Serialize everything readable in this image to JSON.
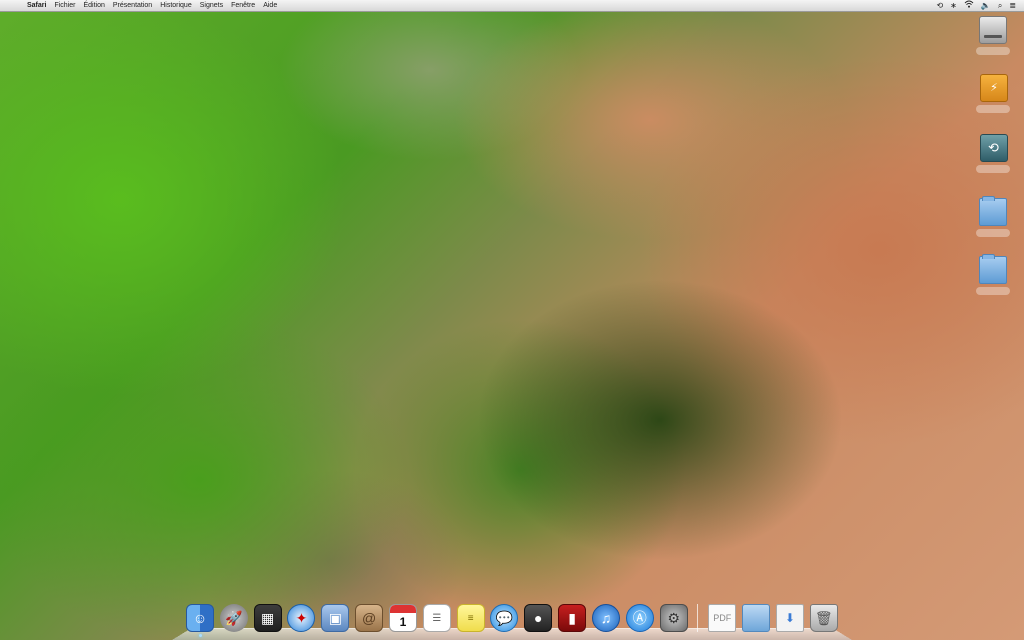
{
  "menubar": {
    "apple_glyph": "",
    "items": [
      "Safari",
      "Fichier",
      "Édition",
      "Présentation",
      "Historique",
      "Signets",
      "Fenêtre",
      "Aide"
    ],
    "status": {
      "time_machine": "⟲",
      "bluetooth": "∗",
      "wifi": "wifi-icon",
      "volume": "🔈",
      "spotlight": "⌕",
      "notifications": "≣"
    }
  },
  "desktop_icons": [
    {
      "name": "hard-drive",
      "icon": "hard-drive-icon",
      "label": ""
    },
    {
      "name": "firewire-drive",
      "icon": "firewire-drive-icon",
      "label": ""
    },
    {
      "name": "time-machine-drive",
      "icon": "time-machine-icon",
      "label": ""
    },
    {
      "name": "folder-1",
      "icon": "folder-icon",
      "label": ""
    },
    {
      "name": "folder-2",
      "icon": "folder-icon",
      "label": ""
    }
  ],
  "dock": {
    "apps": [
      {
        "name": "finder",
        "glyph": "☺",
        "running": true
      },
      {
        "name": "launchpad",
        "glyph": "🚀",
        "running": false
      },
      {
        "name": "mission-control",
        "glyph": "▦",
        "running": false
      },
      {
        "name": "safari",
        "glyph": "✦",
        "running": false
      },
      {
        "name": "preview",
        "glyph": "▣",
        "running": false
      },
      {
        "name": "contacts",
        "glyph": "@",
        "running": false
      },
      {
        "name": "calendar",
        "glyph": "1",
        "running": false
      },
      {
        "name": "reminders",
        "glyph": "☰",
        "running": false
      },
      {
        "name": "stickies",
        "glyph": "≡",
        "running": false
      },
      {
        "name": "messages",
        "glyph": "💬",
        "running": false
      },
      {
        "name": "facetime",
        "glyph": "●",
        "running": false
      },
      {
        "name": "photo-booth",
        "glyph": "▮",
        "running": false
      },
      {
        "name": "itunes",
        "glyph": "♫",
        "running": false
      },
      {
        "name": "app-store",
        "glyph": "Ⓐ",
        "running": false
      },
      {
        "name": "system-preferences",
        "glyph": "⚙",
        "running": false
      }
    ],
    "others": [
      {
        "name": "document",
        "glyph": "PDF"
      },
      {
        "name": "applications-folder",
        "glyph": ""
      },
      {
        "name": "downloads",
        "glyph": "⬇"
      },
      {
        "name": "trash",
        "glyph": "🗑"
      }
    ]
  }
}
